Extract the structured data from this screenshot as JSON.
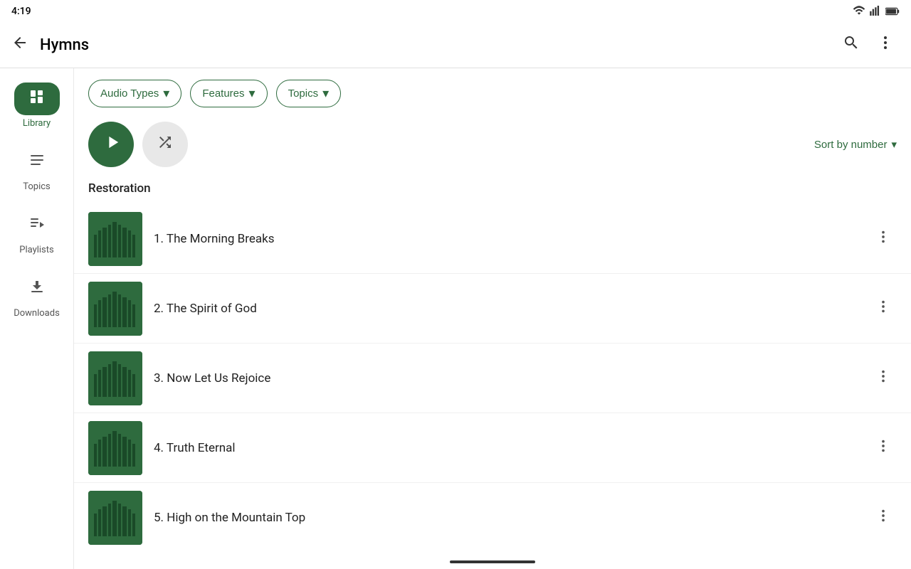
{
  "status": {
    "time": "4:19",
    "icons": [
      "wifi",
      "signal",
      "battery"
    ]
  },
  "appBar": {
    "title": "Hymns",
    "searchLabel": "Search",
    "moreLabel": "More options"
  },
  "sidebar": {
    "items": [
      {
        "id": "library",
        "label": "Library",
        "icon": "library",
        "active": true
      },
      {
        "id": "topics",
        "label": "Topics",
        "icon": "topics",
        "active": false
      },
      {
        "id": "playlists",
        "label": "Playlists",
        "icon": "playlists",
        "active": false
      },
      {
        "id": "downloads",
        "label": "Downloads",
        "icon": "downloads",
        "active": false
      }
    ]
  },
  "filters": {
    "chips": [
      {
        "id": "audio-types",
        "label": "Audio Types"
      },
      {
        "id": "features",
        "label": "Features"
      },
      {
        "id": "topics",
        "label": "Topics"
      }
    ]
  },
  "playback": {
    "playLabel": "Play",
    "shuffleLabel": "Shuffle",
    "sortLabel": "Sort by number"
  },
  "sectionTitle": "Restoration",
  "songs": [
    {
      "number": "1",
      "title": "1. The Morning Breaks"
    },
    {
      "number": "2",
      "title": "2. The Spirit of God"
    },
    {
      "number": "3",
      "title": "3. Now Let Us Rejoice"
    },
    {
      "number": "4",
      "title": "4. Truth Eternal"
    },
    {
      "number": "5",
      "title": "5. High on the Mountain Top"
    }
  ]
}
